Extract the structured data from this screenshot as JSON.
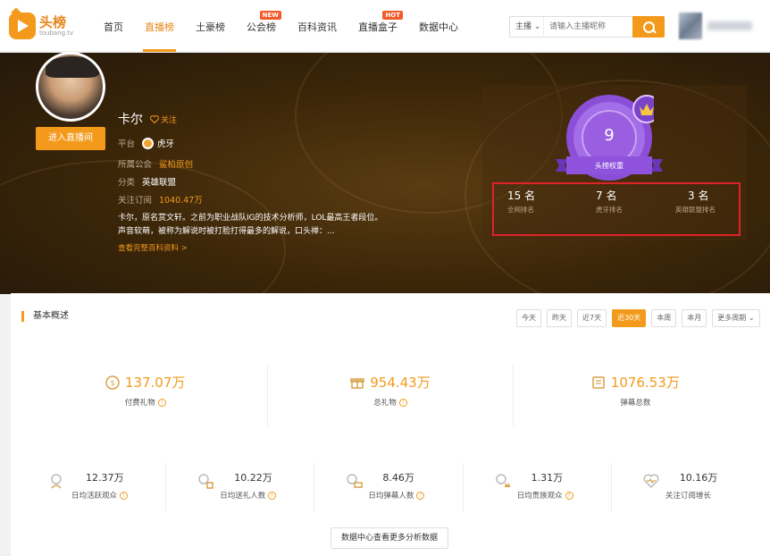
{
  "logo": {
    "title": "头榜",
    "subtitle": "toubang.tv"
  },
  "nav": [
    {
      "label": "首页",
      "active": false,
      "badge": ""
    },
    {
      "label": "直播榜",
      "active": true,
      "badge": ""
    },
    {
      "label": "土豪榜",
      "active": false,
      "badge": ""
    },
    {
      "label": "公会榜",
      "active": false,
      "badge": "NEW"
    },
    {
      "label": "百科资讯",
      "active": false,
      "badge": ""
    },
    {
      "label": "直播盒子",
      "active": false,
      "badge": "HOT"
    },
    {
      "label": "数据中心",
      "active": false,
      "badge": ""
    }
  ],
  "search": {
    "type_label": "主播",
    "placeholder": "请输入主播昵称"
  },
  "streamer": {
    "name": "卡尔",
    "follow_label": "关注",
    "platform_label": "平台",
    "platform_value": "虎牙",
    "guild_label": "所属公会",
    "guild_value": "鲨柏原创",
    "category_label": "分类",
    "category_value": "英雄联盟",
    "subscribers_label": "关注订阅",
    "subscribers_value": "1040.47万",
    "description": "卡尔，原名赏文轩。之前为职业战队IG的技术分析师，LOL最高王者段位。声音软萌，被称为解说时被打脸打得最多的解说，口头禅：...",
    "more_link": "查看完整百科资料 >",
    "enter_button": "进入直播间"
  },
  "ranking": {
    "score": "9",
    "ribbon_label": "头榜权重",
    "items": [
      {
        "value": "15 名",
        "label": "全网排名"
      },
      {
        "value": "7 名",
        "label": "虎牙排名"
      },
      {
        "value": "3 名",
        "label": "英雄联盟排名"
      }
    ]
  },
  "overview": {
    "title": "基本概述",
    "periods": [
      {
        "label": "今天",
        "active": false
      },
      {
        "label": "昨天",
        "active": false
      },
      {
        "label": "近7天",
        "active": false
      },
      {
        "label": "近30天",
        "active": true
      },
      {
        "label": "本周",
        "active": false
      },
      {
        "label": "本月",
        "active": false
      },
      {
        "label": "更多周期 ⌄",
        "active": false
      }
    ],
    "big_stats": [
      {
        "value": "137.07万",
        "label": "付费礼物",
        "icon": "coin-icon"
      },
      {
        "value": "954.43万",
        "label": "总礼物",
        "icon": "gift-icon"
      },
      {
        "value": "1076.53万",
        "label": "弹幕总数",
        "icon": "danmaku-icon"
      }
    ],
    "small_stats": [
      {
        "value": "12.37万",
        "label": "日均活跃观众"
      },
      {
        "value": "10.22万",
        "label": "日均送礼人数"
      },
      {
        "value": "8.46万",
        "label": "日均弹幕人数"
      },
      {
        "value": "1.31万",
        "label": "日均贵族观众"
      },
      {
        "value": "10.16万",
        "label": "关注订阅增长"
      }
    ],
    "data_center_button": "数据中心查看更多分析数据"
  },
  "colors": {
    "accent": "#f39a1c",
    "highlight_box": "#e0222a",
    "medal": "#9a5ee0"
  }
}
